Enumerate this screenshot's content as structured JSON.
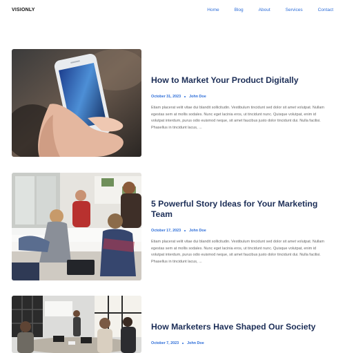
{
  "header": {
    "brand": "VISIONLY",
    "nav": [
      "Home",
      "Blog",
      "About",
      "Services",
      "Contact"
    ]
  },
  "posts": [
    {
      "title": "How to Market Your Product Digitally",
      "date": "October 31, 2023",
      "author": "John Doe",
      "excerpt": "Etiam placerat velit vitae dui blandit sollicitudin. Vestibulum tincidunt sed dolor sit amet volutpat. Nullam egestas sem at mollis sodales. Nunc eget lacinia eros, ut tincidunt nunc. Quisque volutpat, enim id volutpat interdum, purus odio euismod neque, sit amet faucibus justo dolor tincidunt dui. Nulla facilisi. Phasellus in tincidunt lacus, ..."
    },
    {
      "title": "5 Powerful Story Ideas for Your Marketing Team",
      "date": "October 17, 2023",
      "author": "John Doe",
      "excerpt": "Etiam placerat velit vitae dui blandit sollicitudin. Vestibulum tincidunt sed dolor sit amet volutpat. Nullam egestas sem at mollis sodales. Nunc eget lacinia eros, ut tincidunt nunc. Quisque volutpat, enim id volutpat interdum, purus odio euismod neque, sit amet faucibus justo dolor tincidunt dui. Nulla facilisi. Phasellus in tincidunt lacus, ..."
    },
    {
      "title": "How Marketers Have Shaped Our Society",
      "date": "October 7, 2023",
      "author": "John Doe",
      "excerpt": ""
    }
  ],
  "colors": {
    "accent": "#2b6cd8",
    "title": "#1c2e57",
    "text": "#666666"
  }
}
